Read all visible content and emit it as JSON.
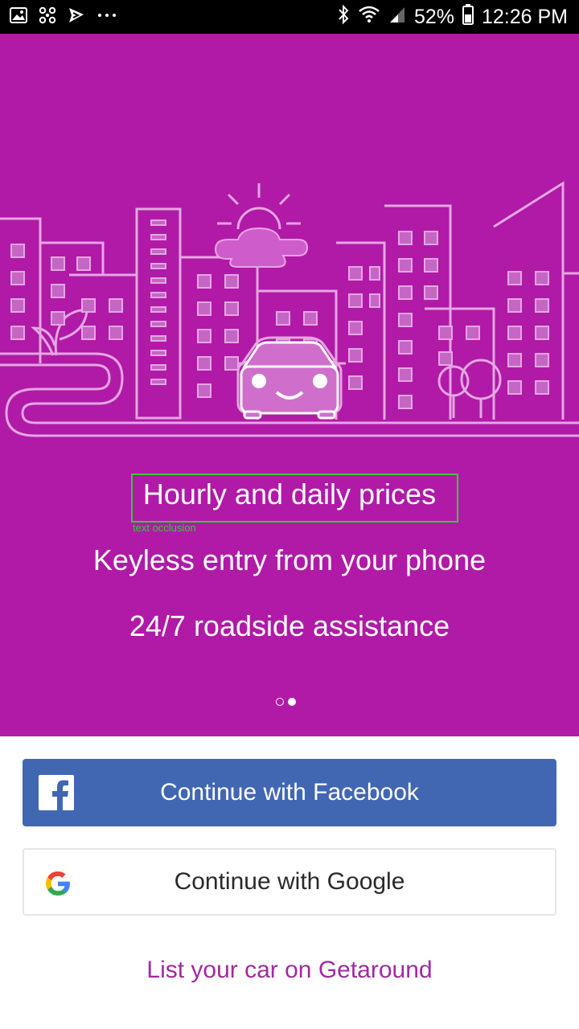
{
  "status_bar": {
    "battery": "52%",
    "time": "12:26 PM"
  },
  "hero": {
    "features": [
      "Hourly and daily prices",
      "Keyless entry from your phone",
      "24/7 roadside assistance"
    ],
    "occlusion_label": "text occlusion",
    "pager": {
      "total": 2,
      "active": 2
    }
  },
  "buttons": {
    "facebook": "Continue with Facebook",
    "google": "Continue with Google"
  },
  "link": "List your car on Getaround",
  "colors": {
    "hero_bg": "#b01aa7",
    "facebook": "#4267b2",
    "link": "#a02a9f"
  },
  "icons": [
    "gallery-icon",
    "pinwheel-icon",
    "send-icon",
    "more-icon",
    "bluetooth-icon",
    "wifi-icon",
    "signal-icon",
    "battery-icon",
    "facebook-icon",
    "google-icon"
  ]
}
